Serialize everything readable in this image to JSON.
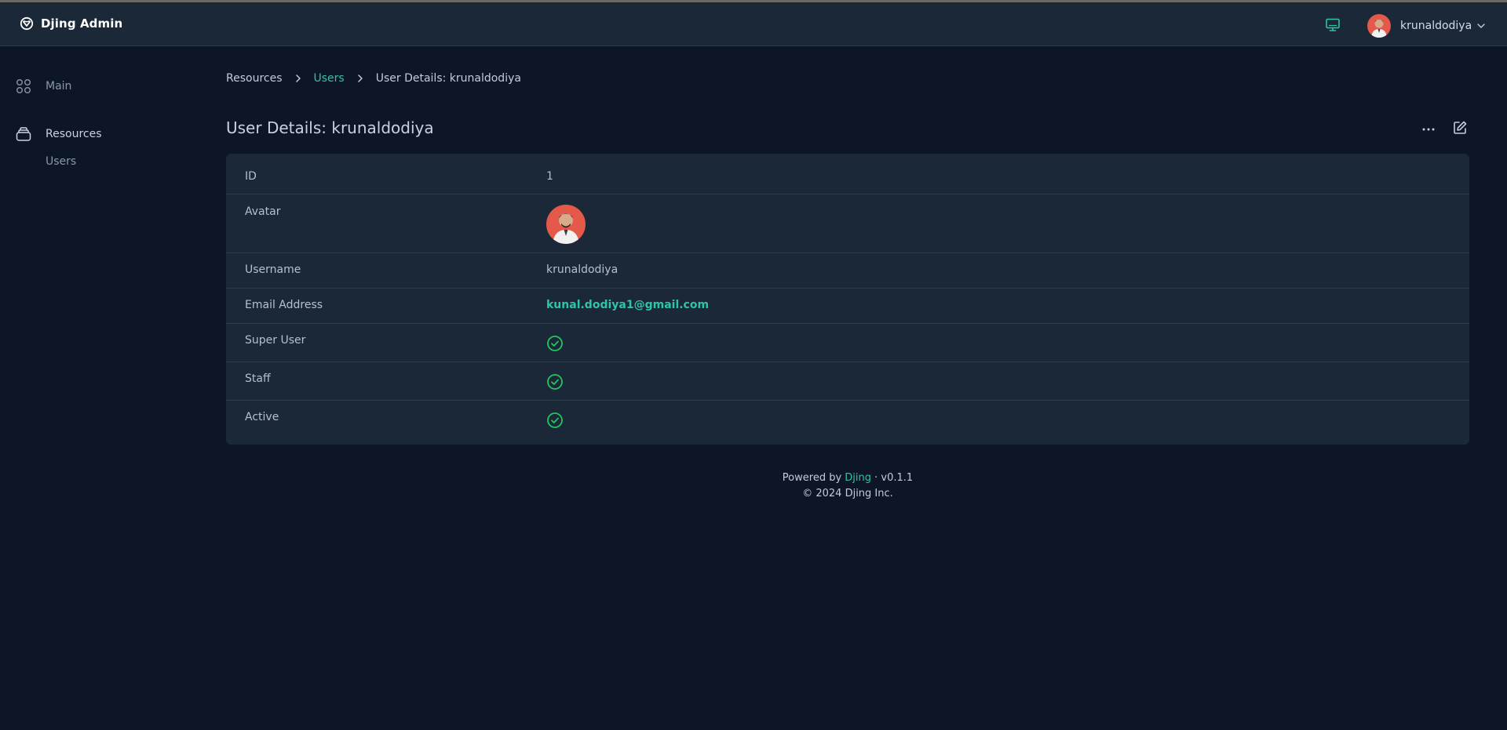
{
  "app": {
    "title": "Djing Admin"
  },
  "header": {
    "username": "krunaldodiya"
  },
  "sidebar": {
    "items": [
      {
        "label": "Main",
        "icon": "grid-icon"
      },
      {
        "label": "Resources",
        "icon": "stack-icon",
        "children": [
          {
            "label": "Users"
          }
        ]
      }
    ]
  },
  "breadcrumb": {
    "items": [
      "Resources",
      "Users",
      "User Details: krunaldodiya"
    ]
  },
  "page": {
    "title": "User Details: krunaldodiya"
  },
  "details": {
    "rows": [
      {
        "label": "ID",
        "value": "1"
      },
      {
        "label": "Avatar",
        "value": ""
      },
      {
        "label": "Username",
        "value": "krunaldodiya"
      },
      {
        "label": "Email Address",
        "value": "kunal.dodiya1@gmail.com"
      },
      {
        "label": "Super User",
        "value": true
      },
      {
        "label": "Staff",
        "value": true
      },
      {
        "label": "Active",
        "value": true
      }
    ]
  },
  "footer": {
    "powered_prefix": "Powered by ",
    "powered_brand": "Djing",
    "version": " · v0.1.1",
    "copyright": "© 2024 Djing Inc."
  },
  "colors": {
    "accent": "#2ec4a8",
    "background": "#0c1627",
    "surface": "#1b2838",
    "check": "#22c55e"
  }
}
